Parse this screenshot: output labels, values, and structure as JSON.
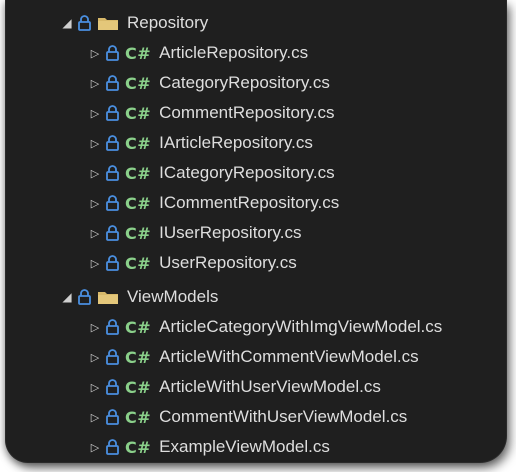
{
  "tree": {
    "folders": [
      {
        "name": "Repository",
        "icon": "folder-icon",
        "files": [
          "ArticleRepository.cs",
          "CategoryRepository.cs",
          "CommentRepository.cs",
          "IArticleRepository.cs",
          "ICategoryRepository.cs",
          "ICommentRepository.cs",
          "IUserRepository.cs",
          "UserRepository.cs"
        ]
      },
      {
        "name": "ViewModels",
        "icon": "folder-icon",
        "files": [
          "ArticleCategoryWithImgViewModel.cs",
          "ArticleWithCommentViewModel.cs",
          "ArticleWithUserViewModel.cs",
          "CommentWithUserViewModel.cs",
          "ExampleViewModel.cs"
        ]
      }
    ],
    "file_badge": "C#",
    "colors": {
      "background": "#1f1f1f",
      "text": "#dedede",
      "csharp_badge": "#8ad08a",
      "lock": "#4a8fe0",
      "folder": "#d8b96a"
    }
  }
}
